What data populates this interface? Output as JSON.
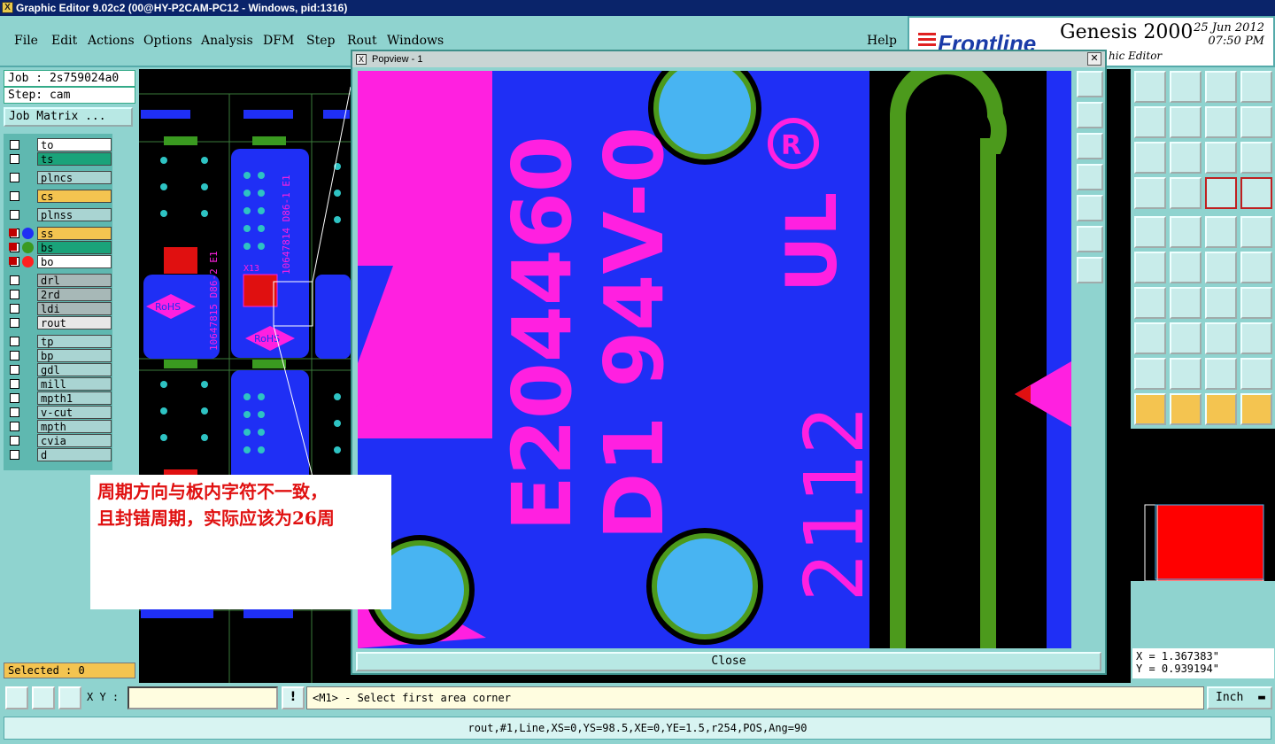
{
  "window": {
    "title": "Graphic Editor 9.02c2 (00@HY-P2CAM-PC12 - Windows, pid:1316)"
  },
  "menu": {
    "items": [
      "File",
      "Edit",
      "Actions",
      "Options",
      "Analysis",
      "DFM",
      "Step",
      "Rout",
      "Windows"
    ],
    "help": "Help"
  },
  "brand": {
    "logo": "Frontline",
    "product": "Genesis 2000",
    "date": "25 Jun 2012",
    "time": "07:50 PM",
    "subtitle": "hic Editor"
  },
  "job": {
    "job_label": "Job : 2s759024a0",
    "step_label": "Step: cam",
    "matrix_button": "Job Matrix ..."
  },
  "layers": [
    {
      "name": "to",
      "color": "#ffffff"
    },
    {
      "name": "ts",
      "color": "#1aa37a"
    },
    {
      "name": "plncs",
      "color": "#a9d4d2"
    },
    {
      "name": "cs",
      "color": "#f4c450"
    },
    {
      "name": "plnss",
      "color": "#a9d4d2"
    },
    {
      "name": "ss",
      "color": "#f4c450"
    },
    {
      "name": "bs",
      "color": "#1aa37a"
    },
    {
      "name": "bo",
      "color": "#ffffff"
    },
    {
      "name": "drl",
      "color": "#a7b8b7"
    },
    {
      "name": "2rd",
      "color": "#a7b8b7"
    },
    {
      "name": "ldi",
      "color": "#a7b8b7"
    },
    {
      "name": "rout",
      "color": "#e8e8e8"
    },
    {
      "name": "tp",
      "color": "#a9d4d2"
    },
    {
      "name": "bp",
      "color": "#a9d4d2"
    },
    {
      "name": "gdl",
      "color": "#a9d4d2"
    },
    {
      "name": "mill",
      "color": "#a9d4d2"
    },
    {
      "name": "mpth1",
      "color": "#a9d4d2"
    },
    {
      "name": "v-cut",
      "color": "#a9d4d2"
    },
    {
      "name": "mpth",
      "color": "#a9d4d2"
    },
    {
      "name": "cvia",
      "color": "#a9d4d2"
    },
    {
      "name": "d",
      "color": "#a9d4d2"
    }
  ],
  "selected": "Selected : 0",
  "popup": {
    "title": "Popview - 1",
    "close_button": "Close",
    "board_text": {
      "line1": "E204460",
      "line2": "D1 94V-0",
      "date_code": "2112"
    }
  },
  "annotation": {
    "line1": "周期方向与板内字符不一致，",
    "line2": "且封错周期，实际应该为26周"
  },
  "canvas_text": {
    "rohs": "RoHS",
    "part_a": "10647815 D86-2 E1",
    "part_b": "10647814 D86-1 E1",
    "x13": "X13"
  },
  "coords": {
    "x": "X = 1.367383\"",
    "y": "Y = 0.939194\""
  },
  "bottom": {
    "xy_label": "X Y :",
    "prompt": "<M1> - Select first area corner",
    "unit": "Inch",
    "feature_line": "rout,#1,Line,XS=0,YS=98.5,XE=0,YE=1.5,r254,POS,Ang=90"
  },
  "colors": {
    "board_blue": "#1f2ff5",
    "silkscreen_magenta": "#ff20e0",
    "pad_cyan": "#48b4f2",
    "trace_green": "#4c9a1c",
    "panel_teal": "#8fd3cf"
  },
  "icons": {
    "pop_side": [
      "zoom-fit-icon",
      "move-up-icon",
      "move-down-icon",
      "move-left-icon",
      "move-right-icon",
      "zoom-in-icon",
      "zoom-out-icon"
    ]
  }
}
